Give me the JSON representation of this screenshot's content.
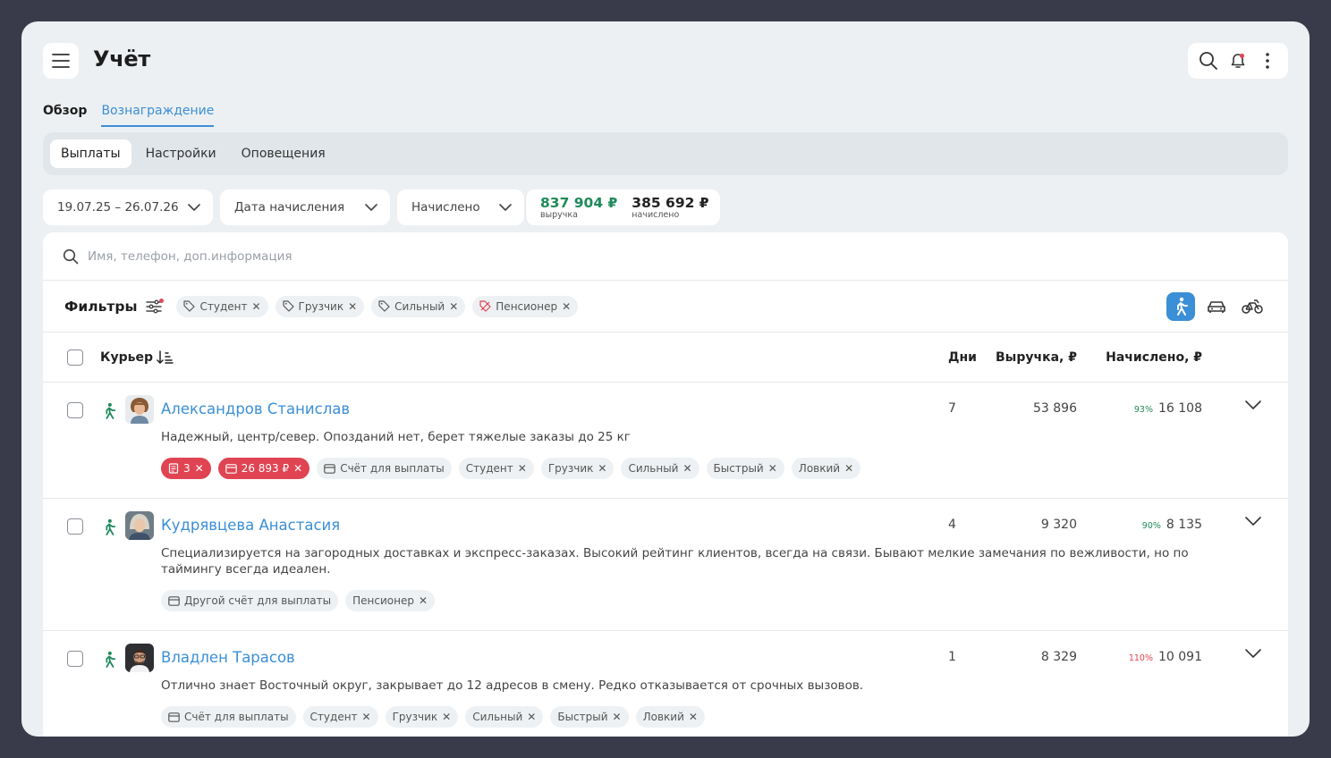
{
  "header": {
    "title": "Учёт"
  },
  "tabs": [
    {
      "label": "Обзор"
    },
    {
      "label": "Вознаграждение"
    }
  ],
  "subtabs": [
    {
      "label": "Выплаты"
    },
    {
      "label": "Настройки"
    },
    {
      "label": "Оповещения"
    }
  ],
  "filters": {
    "date_range": "19.07.25 – 26.07.26",
    "date_type": "Дата начисления",
    "status": "Начислено",
    "revenue_value": "837 904 ₽",
    "revenue_label": "выручка",
    "accrued_value": "385 692 ₽",
    "accrued_label": "начислено"
  },
  "search": {
    "placeholder": "Имя, телефон, доп.информация"
  },
  "filter_bar": {
    "title": "Фильтры",
    "chips": [
      {
        "label": "Студент"
      },
      {
        "label": "Грузчик"
      },
      {
        "label": "Сильный"
      },
      {
        "label": "Пенсионер"
      }
    ]
  },
  "table": {
    "headers": {
      "courier": "Курьер",
      "days": "Дни",
      "revenue": "Выручка, ₽",
      "accrued": "Начислено, ₽"
    },
    "rows": [
      {
        "name": "Александров Станислав",
        "description": "Надежный, центр/север. Опозданий нет, берет тяжелые заказы до 25 кг",
        "days": "7",
        "revenue": "53 896",
        "percent": "93%",
        "accrued": "16 108",
        "alert_tags": [
          "3",
          "26 893 ₽"
        ],
        "account_tag": "Счёт для выплаты",
        "tags": [
          "Студент",
          "Грузчик",
          "Сильный",
          "Быстрый",
          "Ловкий"
        ]
      },
      {
        "name": "Кудрявцева Анастасия",
        "description": "Специализируется на загородных доставках и экспресс-заказах. Высокий рейтинг клиентов, всегда на связи. Бывают мелкие замечания по вежливости, но по таймингу всегда идеален.",
        "days": "4",
        "revenue": "9 320",
        "percent": "90%",
        "accrued": "8 135",
        "account_tag": "Другой счёт для выплаты",
        "tags": [
          "Пенсионер"
        ]
      },
      {
        "name": "Владлен Тарасов",
        "description": "Отлично знает Восточный округ, закрывает до 12 адресов в смену. Редко отказывается от срочных вызовов.",
        "days": "1",
        "revenue": "8 329",
        "percent": "110%",
        "accrued": "10 091",
        "account_tag": "Счёт для выплаты",
        "tags": [
          "Студент",
          "Грузчик",
          "Сильный",
          "Быстрый",
          "Ловкий"
        ]
      }
    ]
  },
  "colors": {
    "accent": "#3b8fd6",
    "positive": "#1f8a5b",
    "negative": "#e04452"
  },
  "icons": [
    "menu-icon",
    "search-icon",
    "bell-icon",
    "more-vertical-icon",
    "chevron-down-icon",
    "filter-sliders-icon",
    "tag-icon",
    "walk-icon",
    "car-icon",
    "bicycle-icon",
    "sort-icon",
    "card-icon",
    "receipt-icon"
  ]
}
